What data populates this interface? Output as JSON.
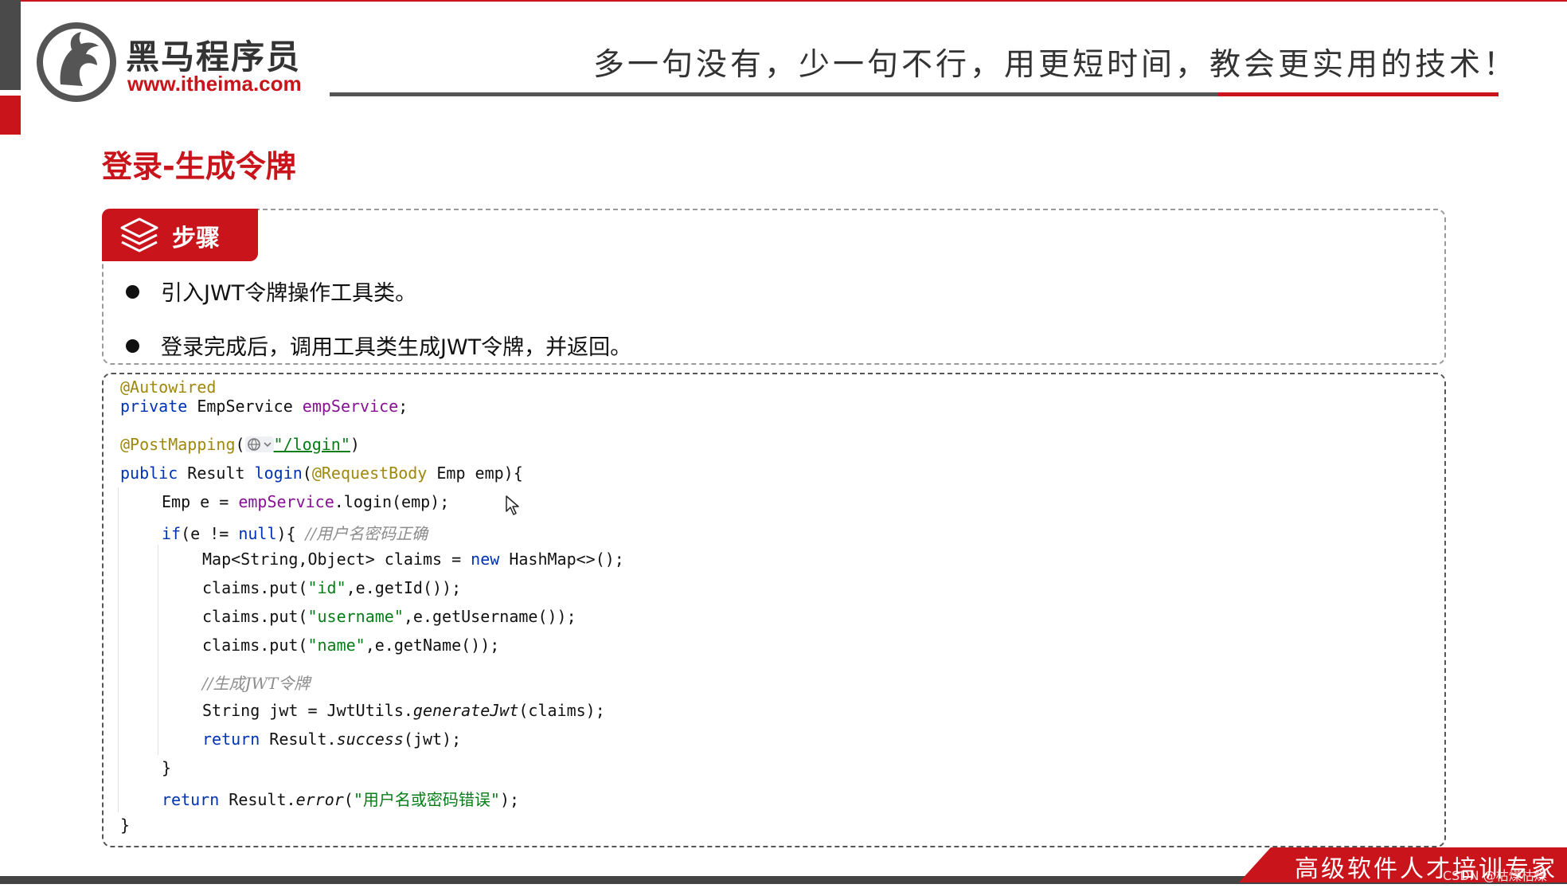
{
  "header": {
    "brand_name": "黑马程序员",
    "brand_url": "www.itheima.com",
    "slogan": "多一句没有，少一句不行，用更短时间，教会更实用的技术！"
  },
  "page": {
    "title": "登录-生成令牌"
  },
  "steps": {
    "label": "步骤",
    "items": [
      "引入JWT令牌操作工具类。",
      "登录完成后，调用工具类生成JWT令牌，并返回。"
    ]
  },
  "code": {
    "autowired": "@Autowired",
    "private_kw": "private",
    "emp_service_type": " EmpService ",
    "emp_service_field": "empService",
    "semicolon": ";",
    "post_mapping": "@PostMapping",
    "open_paren": "(",
    "login_path": "\"/login\"",
    "close_paren": ")",
    "public_kw": "public",
    "result_type": " Result ",
    "login_method": "login",
    "request_body": "@RequestBody",
    "emp_param": " Emp emp){",
    "emp_e_prefix": "Emp e = ",
    "login_call": ".login(emp);",
    "if_kw": "if",
    "if_cond": "(e != ",
    "null_kw": "null",
    "if_close": "){ ",
    "comment_correct": "//用户名密码正确",
    "map_decl": "Map<String,Object> claims = ",
    "new_kw": "new",
    "hashmap": " HashMap<>();",
    "put_prefix": "claims.put(",
    "id_key": "\"id\"",
    "id_suffix": ",e.getId());",
    "username_key": "\"username\"",
    "username_suffix": ",e.getUsername());",
    "name_key": "\"name\"",
    "name_suffix": ",e.getName());",
    "comment_jwt": "//生成JWT令牌",
    "jwt_prefix": "String jwt = JwtUtils.",
    "generate_jwt": "generateJwt",
    "jwt_suffix": "(claims);",
    "return_kw": "return",
    "result_dot": " Result.",
    "success_method": "success",
    "success_suffix": "(jwt);",
    "close_brace": "}",
    "error_method": "error",
    "error_open": "(",
    "error_msg": "\"用户名或密码错误\"",
    "error_close": ");"
  },
  "footer": {
    "tagline": "高级软件人才培训专家",
    "watermark": "CSDN @枯燥枯燥"
  },
  "colors": {
    "brand_red": "#c9141b",
    "annotation": "#9e880d",
    "keyword": "#0033b3",
    "field": "#871094",
    "string": "#067d17",
    "comment": "#8c8c8c"
  }
}
